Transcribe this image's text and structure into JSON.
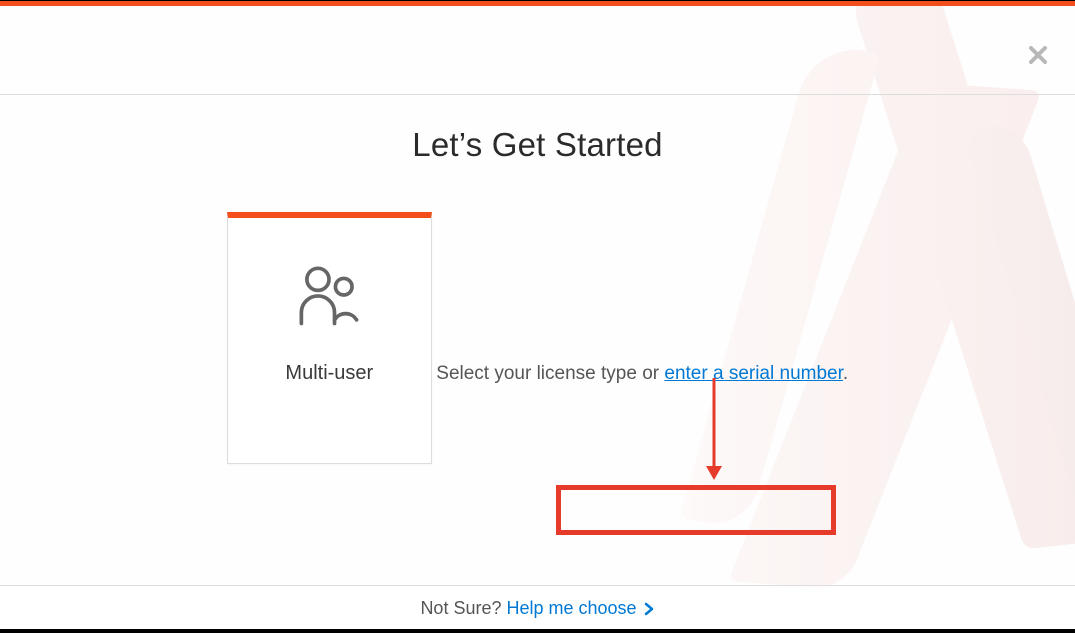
{
  "title": "Let’s Get Started",
  "card": {
    "label": "Multi-user",
    "icon": "users-icon"
  },
  "instruction": {
    "prefix": "Select your license type or ",
    "link": "enter a serial number",
    "suffix": "."
  },
  "footer": {
    "prefix": "Not Sure? ",
    "link": "Help me choose"
  },
  "annotation": {
    "highlight": true,
    "arrow": true
  }
}
